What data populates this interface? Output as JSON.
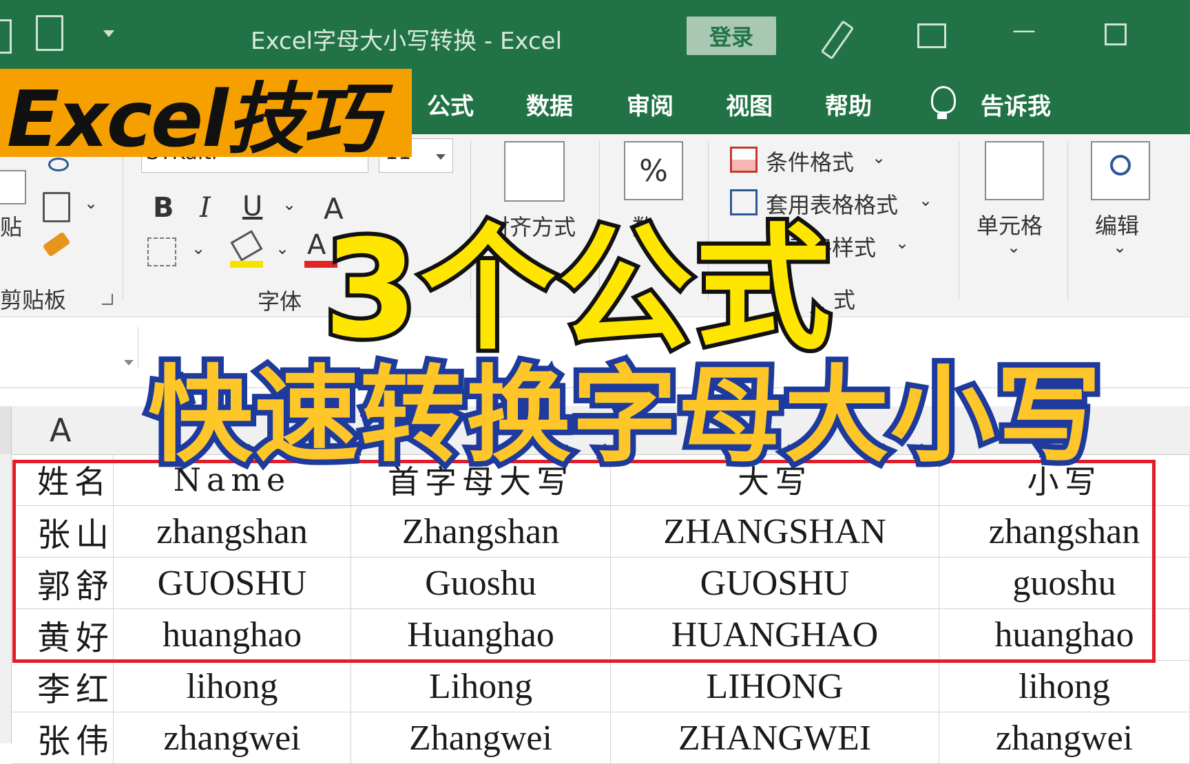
{
  "window": {
    "title": "Excel字母大小写转换  -  Excel",
    "login_label": "登录",
    "minimize_glyph": "—",
    "restore_glyph": "☐"
  },
  "ribbon_tabs": [
    "公式",
    "数据",
    "审阅",
    "视图",
    "帮助"
  ],
  "tell_me": "告诉我",
  "ribbon": {
    "font_name": "STKaiti",
    "font_size": "11",
    "clipboard_label": "剪贴板",
    "paste_label": "贴",
    "font_group_label": "字体",
    "bold": "B",
    "italic": "I",
    "underline": "U",
    "font_color_letter": "A",
    "grow_font_letter": "A",
    "percent_glyph": "%",
    "align_partial": "对齐方式",
    "number_partial": "数",
    "conditional_format": "条件格式",
    "table_format": "套用表格格式",
    "cell_styles": "单元格样式",
    "styles_partial": "式",
    "cells_label": "单元格",
    "edit_label": "编辑",
    "font_color_bar": "#e02424",
    "fill_color_bar": "#f5e400"
  },
  "columns": [
    "A",
    "E"
  ],
  "table": {
    "rows": [
      [
        "姓名",
        "Name",
        "首字母大写",
        "大写",
        "小写"
      ],
      [
        "张山",
        "zhangshan",
        "Zhangshan",
        "ZHANGSHAN",
        "zhangshan"
      ],
      [
        "郭舒",
        "GUOSHU",
        "Guoshu",
        "GUOSHU",
        "guoshu"
      ],
      [
        "黄好",
        "huanghao",
        "Huanghao",
        "HUANGHAO",
        "huanghao"
      ],
      [
        "李红",
        "lihong",
        "Lihong",
        "LIHONG",
        "lihong"
      ],
      [
        "张伟",
        "zhangwei",
        "Zhangwei",
        "ZHANGWEI",
        "zhangwei"
      ]
    ]
  },
  "overlay": {
    "badge": "Excel技巧",
    "headline1": "3个公式",
    "headline2": "快速转换字母大小写",
    "badge_color": "#f6a000",
    "headline1_color": "#ffe600",
    "headline2_color": "#ffc629",
    "highlight_border": "#e11d2a"
  },
  "accent": "#217346"
}
